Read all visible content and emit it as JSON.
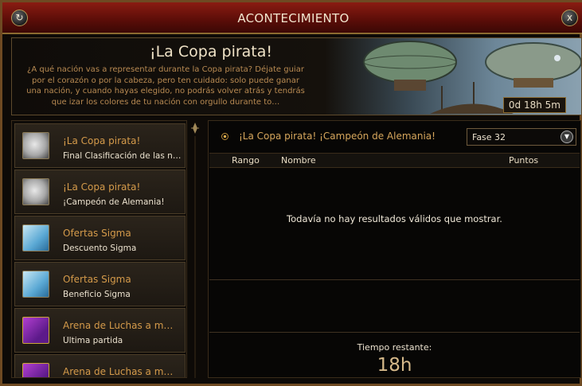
{
  "window": {
    "title": "ACONTECIMIENTO"
  },
  "banner": {
    "title": "¡La Copa pirata!",
    "description": "¿A qué nación vas a representar durante la Copa pirata? Déjate guiar por el corazón o por la cabeza, pero ten cuidado: solo puede ganar una nación, y cuando hayas elegido, no podrás volver atrás y tendrás que izar los colores de tu nación con orgullo durante to…",
    "timer": "0d 18h 5m"
  },
  "event_list": [
    {
      "icon": "soccer-ball-icon",
      "title": "¡La Copa pirata!",
      "subtitle": "Final Clasificación de las n…"
    },
    {
      "icon": "soccer-ball-icon",
      "title": "¡La Copa pirata!",
      "subtitle": "¡Campeón de Alemania!"
    },
    {
      "icon": "sigma-offer-icon",
      "title": "Ofertas Sigma",
      "subtitle": "Descuento Sigma"
    },
    {
      "icon": "sigma-offer-icon",
      "title": "Ofertas Sigma",
      "subtitle": "Beneficio Sigma"
    },
    {
      "icon": "arena-icon",
      "title": "Arena de Luchas a m…",
      "subtitle": "Última partida"
    },
    {
      "icon": "arena-icon",
      "title": "Arena de Luchas a m…",
      "subtitle": ""
    }
  ],
  "detail": {
    "event_name": "¡La Copa pirata! ¡Campeón de Alemania!",
    "phase_select": "Fase 32",
    "columns": {
      "rank": "Rango",
      "name": "Nombre",
      "points": "Puntos"
    },
    "empty_message": "Todavía no hay resultados válidos que mostrar.",
    "remaining_label": "Tiempo restante:",
    "remaining_value": "18h"
  },
  "colors": {
    "title_bar": "#8a1c12",
    "accent_gold": "#d49a4a",
    "frame": "#6e4a22"
  }
}
